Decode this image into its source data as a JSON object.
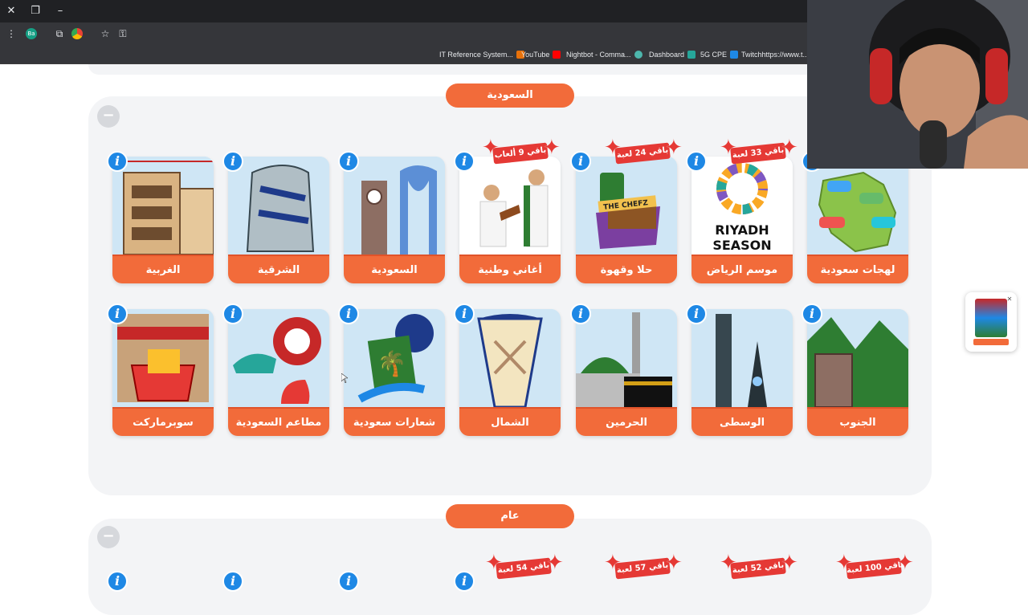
{
  "browser": {
    "profile_initials": "Ba",
    "bookmarks": [
      {
        "label": "IT Reference System...",
        "icon_color": "#e8710a"
      },
      {
        "label": "YouTube",
        "icon_color": "#ff0000"
      },
      {
        "label": "Nightbot - Comma...",
        "icon_color": "#4db6ac"
      },
      {
        "label": "Dashboard",
        "icon_color": "#26a69a"
      },
      {
        "label": "5G CPE",
        "icon_color": "#1e88e5"
      },
      {
        "label": "Twitchhttps://www.t...",
        "icon_color": "#9146ff"
      }
    ]
  },
  "colors": {
    "accent": "#f26b3a",
    "info": "#1e88e5",
    "ribbon": "#e53935",
    "panel": "#f3f4f6"
  },
  "sections": [
    {
      "title": "السعودية",
      "collapse_symbol": "−",
      "rows": [
        [
          {
            "label": "لهجات سعودية",
            "ribbon": ""
          },
          {
            "label": "موسم الرياض",
            "ribbon": "باقي 33 لعبة"
          },
          {
            "label": "حلا وقهوة",
            "ribbon": "باقي 24 لعبة"
          },
          {
            "label": "أغاني وطنية",
            "ribbon": "باقي 9 ألعاب"
          },
          {
            "label": "السعودية",
            "ribbon": ""
          },
          {
            "label": "الشرقية",
            "ribbon": ""
          },
          {
            "label": "الغربية",
            "ribbon": ""
          }
        ],
        [
          {
            "label": "الجنوب",
            "ribbon": ""
          },
          {
            "label": "الوسطى",
            "ribbon": ""
          },
          {
            "label": "الحرمين",
            "ribbon": ""
          },
          {
            "label": "الشمال",
            "ribbon": ""
          },
          {
            "label": "شعارات سعودية",
            "ribbon": ""
          },
          {
            "label": "مطاعم السعودية",
            "ribbon": ""
          },
          {
            "label": "سوبرماركت",
            "ribbon": ""
          }
        ]
      ],
      "art_text": {
        "riyadh_line1": "RIYADH",
        "riyadh_line2": "SEASON",
        "chefz": "THE CHEFZ"
      }
    },
    {
      "title": "عام",
      "collapse_symbol": "−",
      "ribbons": [
        "باقي 100 لعبة",
        "باقي 52 لعبة",
        "باقي 57 لعبة",
        "باقي 54 لعبة"
      ]
    }
  ]
}
